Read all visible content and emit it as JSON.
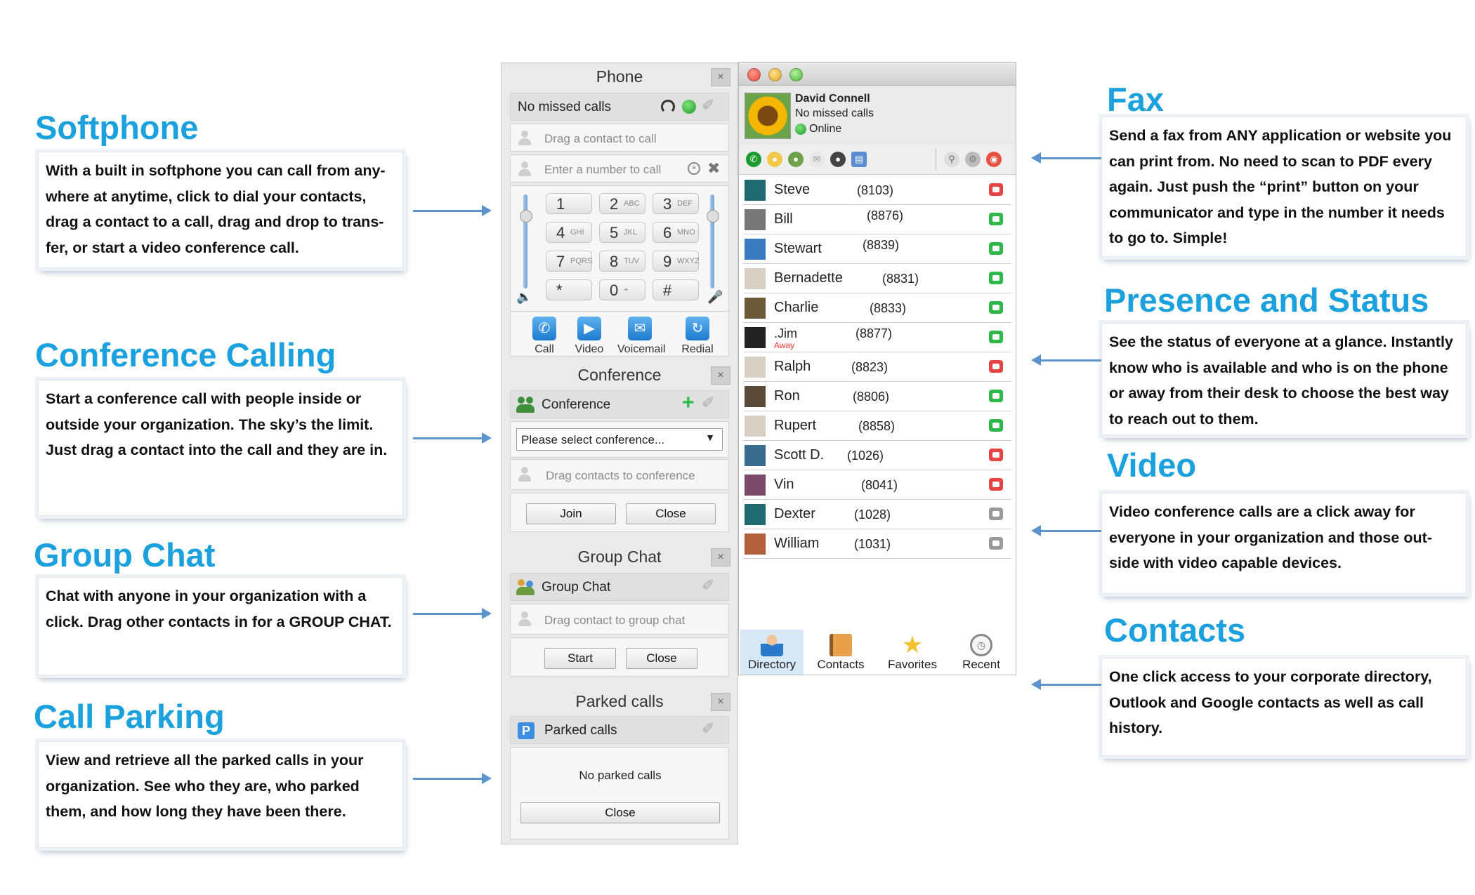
{
  "features": [
    {
      "title": "Softphone",
      "text": "With a built in softphone you can call from any-where at anytime, click to dial your contacts, drag a contact to a call, drag and drop to trans-fer, or start a video conference call."
    },
    {
      "title": "Conference Calling",
      "text": "Start a conference call with people inside or outside your organization. The sky’s the limit. Just drag a contact into the call and they are in."
    },
    {
      "title": "Group Chat",
      "text": "Chat with anyone in your organization with a click. Drag other contacts in for a GROUP CHAT."
    },
    {
      "title": "Call Parking",
      "text": "View and retrieve all the parked calls in your organization. See who they are, who parked them, and how long they have been there."
    },
    {
      "title": "Fax",
      "text": "Send a fax from ANY application or website you can print from. No need to scan to PDF every again. Just push the “print” button on your communicator and type in the number it needs to go to. Simple!"
    },
    {
      "title": "Presence and Status",
      "text": "See the status of everyone at a glance. Instantly know who is available and who is on the phone or away from their desk to choose the best way to reach out to them."
    },
    {
      "title": "Video",
      "text": "Video conference calls are a click away for everyone in your organization and those out-side with video capable devices."
    },
    {
      "title": "Contacts",
      "text": "One click access to your corporate directory, Outlook and Google contacts as well as call history."
    }
  ],
  "phone": {
    "title": "Phone",
    "status": "No missed calls",
    "drag_hint": "Drag a contact to call",
    "number_hint": "Enter a number to call",
    "keys": [
      {
        "d": "1",
        "s": ""
      },
      {
        "d": "2",
        "s": "ABC"
      },
      {
        "d": "3",
        "s": "DEF"
      },
      {
        "d": "4",
        "s": "GHI"
      },
      {
        "d": "5",
        "s": "JKL"
      },
      {
        "d": "6",
        "s": "MNO"
      },
      {
        "d": "7",
        "s": "PQRS"
      },
      {
        "d": "8",
        "s": "TUV"
      },
      {
        "d": "9",
        "s": "WXYZ"
      },
      {
        "d": "*",
        "s": ""
      },
      {
        "d": "0",
        "s": "+"
      },
      {
        "d": "#",
        "s": ""
      }
    ],
    "actions": [
      "Call",
      "Video",
      "Voicemail",
      "Redial"
    ]
  },
  "conference": {
    "title": "Conference",
    "row_label": "Conference",
    "select_value": "Please select conference...",
    "drag_hint": "Drag contacts to conference",
    "join": "Join",
    "close": "Close"
  },
  "groupchat": {
    "title": "Group Chat",
    "row_label": "Group Chat",
    "drag_hint": "Drag contact to group chat",
    "start": "Start",
    "close": "Close"
  },
  "parked": {
    "title": "Parked calls",
    "row_label": "Parked calls",
    "empty": "No parked calls",
    "close": "Close",
    "icon_letter": "P"
  },
  "close_glyph": "×",
  "directory": {
    "user_name": "David Connell",
    "user_status": "No missed calls",
    "presence": "Online",
    "contacts": [
      {
        "name": "Steve",
        "ext": "(8103)",
        "status": "busy",
        "away": ""
      },
      {
        "name": "Bill",
        "ext": "(8876)",
        "status": "available",
        "away": ""
      },
      {
        "name": "Stewart",
        "ext": "(8839)",
        "status": "available",
        "away": ""
      },
      {
        "name": "Bernadette",
        "ext": "(8831)",
        "status": "available",
        "away": ""
      },
      {
        "name": "Charlie",
        "ext": "(8833)",
        "status": "available",
        "away": ""
      },
      {
        "name": ".Jim",
        "ext": "(8877)",
        "status": "available",
        "away": "Away"
      },
      {
        "name": "Ralph",
        "ext": "(8823)",
        "status": "busy",
        "away": ""
      },
      {
        "name": "Ron",
        "ext": "(8806)",
        "status": "available",
        "away": ""
      },
      {
        "name": "Rupert",
        "ext": "(8858)",
        "status": "available",
        "away": ""
      },
      {
        "name": "Scott D.",
        "ext": "(1026)",
        "status": "busy",
        "away": ""
      },
      {
        "name": "Vin",
        "ext": "(8041)",
        "status": "busy",
        "away": ""
      },
      {
        "name": "Dexter",
        "ext": "(1028)",
        "status": "offline",
        "away": ""
      },
      {
        "name": "William",
        "ext": "(1031)",
        "status": "offline",
        "away": ""
      }
    ],
    "tabs": [
      "Directory",
      "Contacts",
      "Favorites",
      "Recent"
    ]
  },
  "colors": {
    "accent": "#1ba1dd",
    "arrow": "#5b93cc",
    "available": "#2fb84a",
    "busy": "#e84343",
    "offline": "#9a9a9a"
  }
}
